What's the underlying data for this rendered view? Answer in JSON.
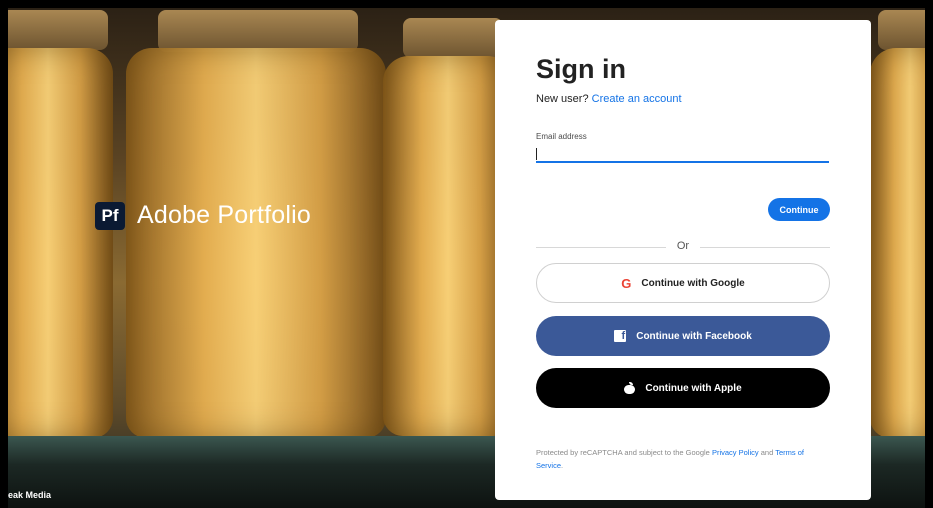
{
  "brand": {
    "logo_text": "Pf",
    "name": "Adobe Portfolio"
  },
  "credit": "eak Media",
  "signin": {
    "title": "Sign in",
    "new_user_prefix": "New user?",
    "create_account_link": "Create an account",
    "email_label": "Email address",
    "email_value": "",
    "continue_button": "Continue",
    "divider_text": "Or",
    "google_button": "Continue with Google",
    "facebook_button": "Continue with Facebook",
    "apple_button": "Continue with Apple",
    "legal_prefix": "Protected by reCAPTCHA and subject to the Google",
    "privacy_link": "Privacy Policy",
    "legal_and": "and",
    "terms_link": "Terms of Service",
    "legal_suffix": "."
  },
  "icons": {
    "google": "google-icon",
    "facebook": "facebook-icon",
    "apple": "apple-icon"
  },
  "colors": {
    "accent": "#1473e6",
    "facebook": "#3b5998",
    "apple": "#000000",
    "logo_bg": "#0b1a33"
  }
}
